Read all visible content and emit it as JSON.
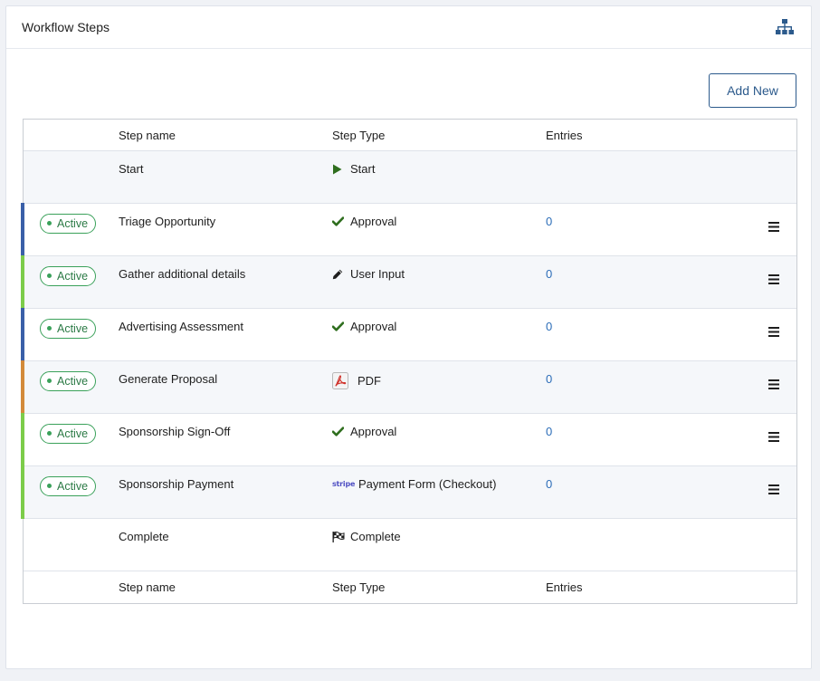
{
  "panel": {
    "title": "Workflow Steps",
    "header_icon": "sitemap-icon"
  },
  "toolbar": {
    "add_new_label": "Add New"
  },
  "table": {
    "columns": {
      "step_name": "Step name",
      "step_type": "Step Type",
      "entries": "Entries"
    },
    "start_row": {
      "name": "Start",
      "type": "Start",
      "type_icon": "play-icon"
    },
    "steps": [
      {
        "status": "Active",
        "name": "Triage Opportunity",
        "type": "Approval",
        "type_icon": "check-icon",
        "entries": "0",
        "accent": "#3a5fa8"
      },
      {
        "status": "Active",
        "name": "Gather additional details",
        "type": "User Input",
        "type_icon": "pencil-icon",
        "entries": "0",
        "accent": "#7ccc4a"
      },
      {
        "status": "Active",
        "name": "Advertising Assessment",
        "type": "Approval",
        "type_icon": "check-icon",
        "entries": "0",
        "accent": "#3a5fa8"
      },
      {
        "status": "Active",
        "name": "Generate Proposal",
        "type": "PDF",
        "type_icon": "pdf-icon",
        "entries": "0",
        "accent": "#d38a3a"
      },
      {
        "status": "Active",
        "name": "Sponsorship Sign-Off",
        "type": "Approval",
        "type_icon": "check-icon",
        "entries": "0",
        "accent": "#7ccc4a"
      },
      {
        "status": "Active",
        "name": "Sponsorship Payment",
        "type": "Payment Form (Checkout)",
        "type_icon": "stripe-icon",
        "type_icon_text": "stripe",
        "entries": "0",
        "accent": "#7ccc4a"
      }
    ],
    "complete_row": {
      "name": "Complete",
      "type": "Complete",
      "type_icon": "checkered-flag-icon"
    }
  },
  "colors": {
    "link": "#2c6db8",
    "button_border": "#2c5a8c",
    "active_badge": "#3aa15a"
  }
}
